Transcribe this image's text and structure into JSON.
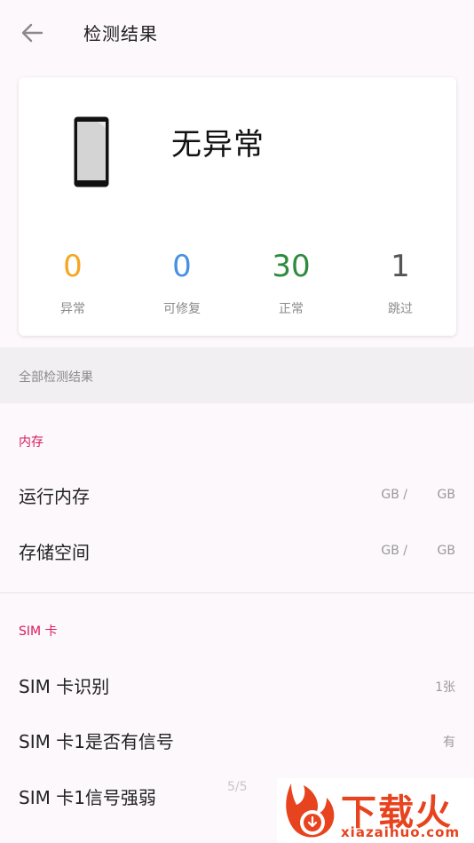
{
  "header": {
    "title": "检测结果"
  },
  "summary": {
    "status": "无异常",
    "stats": [
      {
        "value": "0",
        "label": "异常",
        "color": "#f5a623"
      },
      {
        "value": "0",
        "label": "可修复",
        "color": "#4a90e2"
      },
      {
        "value": "30",
        "label": "正常",
        "color": "#2e8b3e"
      },
      {
        "value": "1",
        "label": "跳过",
        "color": "#555555"
      }
    ]
  },
  "section_header": "全部检测结果",
  "groups": [
    {
      "title": "内存",
      "items": [
        {
          "label": "运行内存",
          "value_a": "GB /",
          "value_b": "GB"
        },
        {
          "label": "存储空间",
          "value_a": "GB /",
          "value_b": "GB"
        }
      ]
    },
    {
      "title": "SIM 卡",
      "items": [
        {
          "label": "SIM 卡识别",
          "value": "1张"
        },
        {
          "label": "SIM 卡1是否有信号",
          "value": "有"
        },
        {
          "label": "SIM 卡1信号强弱",
          "value": ""
        }
      ]
    }
  ],
  "page_indicator": "5/5",
  "watermark": {
    "text": "下载火",
    "url": "xiazaihuo.com"
  },
  "colors": {
    "accent": "#d81b60",
    "watermark": "#e8431f"
  }
}
